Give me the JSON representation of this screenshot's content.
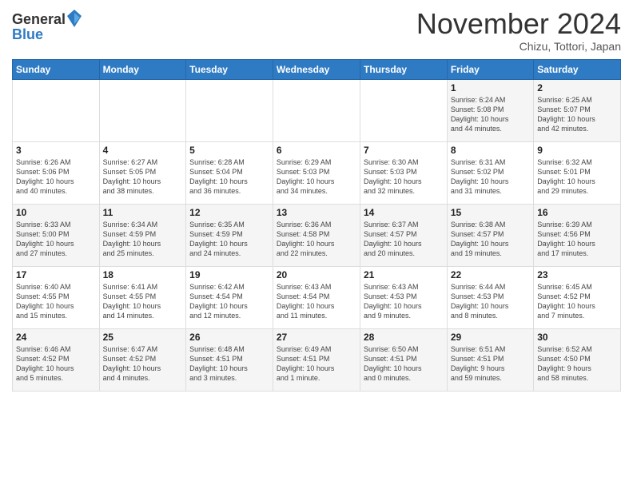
{
  "header": {
    "logo_general": "General",
    "logo_blue": "Blue",
    "month_title": "November 2024",
    "subtitle": "Chizu, Tottori, Japan"
  },
  "days_of_week": [
    "Sunday",
    "Monday",
    "Tuesday",
    "Wednesday",
    "Thursday",
    "Friday",
    "Saturday"
  ],
  "weeks": [
    [
      {
        "day": "",
        "info": ""
      },
      {
        "day": "",
        "info": ""
      },
      {
        "day": "",
        "info": ""
      },
      {
        "day": "",
        "info": ""
      },
      {
        "day": "",
        "info": ""
      },
      {
        "day": "1",
        "info": "Sunrise: 6:24 AM\nSunset: 5:08 PM\nDaylight: 10 hours\nand 44 minutes."
      },
      {
        "day": "2",
        "info": "Sunrise: 6:25 AM\nSunset: 5:07 PM\nDaylight: 10 hours\nand 42 minutes."
      }
    ],
    [
      {
        "day": "3",
        "info": "Sunrise: 6:26 AM\nSunset: 5:06 PM\nDaylight: 10 hours\nand 40 minutes."
      },
      {
        "day": "4",
        "info": "Sunrise: 6:27 AM\nSunset: 5:05 PM\nDaylight: 10 hours\nand 38 minutes."
      },
      {
        "day": "5",
        "info": "Sunrise: 6:28 AM\nSunset: 5:04 PM\nDaylight: 10 hours\nand 36 minutes."
      },
      {
        "day": "6",
        "info": "Sunrise: 6:29 AM\nSunset: 5:03 PM\nDaylight: 10 hours\nand 34 minutes."
      },
      {
        "day": "7",
        "info": "Sunrise: 6:30 AM\nSunset: 5:03 PM\nDaylight: 10 hours\nand 32 minutes."
      },
      {
        "day": "8",
        "info": "Sunrise: 6:31 AM\nSunset: 5:02 PM\nDaylight: 10 hours\nand 31 minutes."
      },
      {
        "day": "9",
        "info": "Sunrise: 6:32 AM\nSunset: 5:01 PM\nDaylight: 10 hours\nand 29 minutes."
      }
    ],
    [
      {
        "day": "10",
        "info": "Sunrise: 6:33 AM\nSunset: 5:00 PM\nDaylight: 10 hours\nand 27 minutes."
      },
      {
        "day": "11",
        "info": "Sunrise: 6:34 AM\nSunset: 4:59 PM\nDaylight: 10 hours\nand 25 minutes."
      },
      {
        "day": "12",
        "info": "Sunrise: 6:35 AM\nSunset: 4:59 PM\nDaylight: 10 hours\nand 24 minutes."
      },
      {
        "day": "13",
        "info": "Sunrise: 6:36 AM\nSunset: 4:58 PM\nDaylight: 10 hours\nand 22 minutes."
      },
      {
        "day": "14",
        "info": "Sunrise: 6:37 AM\nSunset: 4:57 PM\nDaylight: 10 hours\nand 20 minutes."
      },
      {
        "day": "15",
        "info": "Sunrise: 6:38 AM\nSunset: 4:57 PM\nDaylight: 10 hours\nand 19 minutes."
      },
      {
        "day": "16",
        "info": "Sunrise: 6:39 AM\nSunset: 4:56 PM\nDaylight: 10 hours\nand 17 minutes."
      }
    ],
    [
      {
        "day": "17",
        "info": "Sunrise: 6:40 AM\nSunset: 4:55 PM\nDaylight: 10 hours\nand 15 minutes."
      },
      {
        "day": "18",
        "info": "Sunrise: 6:41 AM\nSunset: 4:55 PM\nDaylight: 10 hours\nand 14 minutes."
      },
      {
        "day": "19",
        "info": "Sunrise: 6:42 AM\nSunset: 4:54 PM\nDaylight: 10 hours\nand 12 minutes."
      },
      {
        "day": "20",
        "info": "Sunrise: 6:43 AM\nSunset: 4:54 PM\nDaylight: 10 hours\nand 11 minutes."
      },
      {
        "day": "21",
        "info": "Sunrise: 6:43 AM\nSunset: 4:53 PM\nDaylight: 10 hours\nand 9 minutes."
      },
      {
        "day": "22",
        "info": "Sunrise: 6:44 AM\nSunset: 4:53 PM\nDaylight: 10 hours\nand 8 minutes."
      },
      {
        "day": "23",
        "info": "Sunrise: 6:45 AM\nSunset: 4:52 PM\nDaylight: 10 hours\nand 7 minutes."
      }
    ],
    [
      {
        "day": "24",
        "info": "Sunrise: 6:46 AM\nSunset: 4:52 PM\nDaylight: 10 hours\nand 5 minutes."
      },
      {
        "day": "25",
        "info": "Sunrise: 6:47 AM\nSunset: 4:52 PM\nDaylight: 10 hours\nand 4 minutes."
      },
      {
        "day": "26",
        "info": "Sunrise: 6:48 AM\nSunset: 4:51 PM\nDaylight: 10 hours\nand 3 minutes."
      },
      {
        "day": "27",
        "info": "Sunrise: 6:49 AM\nSunset: 4:51 PM\nDaylight: 10 hours\nand 1 minute."
      },
      {
        "day": "28",
        "info": "Sunrise: 6:50 AM\nSunset: 4:51 PM\nDaylight: 10 hours\nand 0 minutes."
      },
      {
        "day": "29",
        "info": "Sunrise: 6:51 AM\nSunset: 4:51 PM\nDaylight: 9 hours\nand 59 minutes."
      },
      {
        "day": "30",
        "info": "Sunrise: 6:52 AM\nSunset: 4:50 PM\nDaylight: 9 hours\nand 58 minutes."
      }
    ]
  ]
}
